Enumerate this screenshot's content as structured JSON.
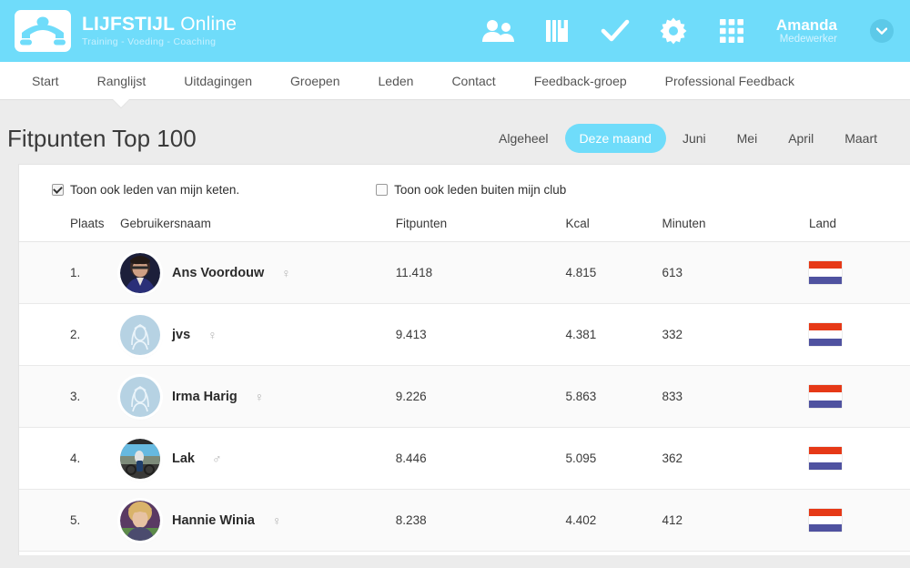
{
  "header": {
    "logo_icon": "pushup-silhouette-logo",
    "brand_title_bold": "LIJFSTIJL",
    "brand_title_thin": " Online",
    "brand_subtitle": "Training - Voeding - Coaching",
    "icons": [
      {
        "name": "people-icon",
        "glyph": "people"
      },
      {
        "name": "book-icon",
        "glyph": "book"
      },
      {
        "name": "check-icon",
        "glyph": "check"
      },
      {
        "name": "gear-icon",
        "glyph": "gear"
      },
      {
        "name": "grid-apps-icon",
        "glyph": "grid"
      }
    ],
    "user_name": "Amanda",
    "user_role": "Medewerker",
    "caret_icon": "chevron-down-icon",
    "background_color": "#6FDCFA"
  },
  "nav": {
    "items": [
      {
        "label": "Start",
        "active": false
      },
      {
        "label": "Ranglijst",
        "active": true
      },
      {
        "label": "Uitdagingen",
        "active": false
      },
      {
        "label": "Groepen",
        "active": false
      },
      {
        "label": "Leden",
        "active": false
      },
      {
        "label": "Contact",
        "active": false
      },
      {
        "label": "Feedback-groep",
        "active": false
      },
      {
        "label": "Professional Feedback",
        "active": false
      }
    ]
  },
  "page": {
    "title": "Fitpunten Top 100",
    "period_tabs": [
      {
        "label": "Algeheel",
        "active": false
      },
      {
        "label": "Deze maand",
        "active": true
      },
      {
        "label": "Juni",
        "active": false
      },
      {
        "label": "Mei",
        "active": false
      },
      {
        "label": "April",
        "active": false
      },
      {
        "label": "Maart",
        "active": false
      }
    ],
    "active_tab_color": "#6FDCFA"
  },
  "filters": [
    {
      "label": "Toon ook leden van mijn keten.",
      "checked": true
    },
    {
      "label": "Toon ook leden buiten mijn club",
      "checked": false
    }
  ],
  "table": {
    "columns": [
      "Plaats",
      "Gebruikersnaam",
      "Fitpunten",
      "Kcal",
      "Minuten",
      "Land"
    ],
    "rows": [
      {
        "plaats": "1.",
        "naam": "Ans Voordouw",
        "gender": "♀",
        "avatar_type": "photo-dark",
        "fitpunten": "11.418",
        "kcal": "4.815",
        "minuten": "613",
        "land": "nl-flag-icon"
      },
      {
        "plaats": "2.",
        "naam": "jvs",
        "gender": "♀",
        "avatar_type": "placeholder-female",
        "fitpunten": "9.413",
        "kcal": "4.381",
        "minuten": "332",
        "land": "nl-flag-icon"
      },
      {
        "plaats": "3.",
        "naam": "Irma Harig",
        "gender": "♀",
        "avatar_type": "placeholder-female",
        "fitpunten": "9.226",
        "kcal": "5.863",
        "minuten": "833",
        "land": "nl-flag-icon"
      },
      {
        "plaats": "4.",
        "naam": "Lak",
        "gender": "♂",
        "avatar_type": "photo-bike",
        "fitpunten": "8.446",
        "kcal": "5.095",
        "minuten": "362",
        "land": "nl-flag-icon"
      },
      {
        "plaats": "5.",
        "naam": "Hannie Winia",
        "gender": "♀",
        "avatar_type": "photo-blonde",
        "fitpunten": "8.238",
        "kcal": "4.402",
        "minuten": "412",
        "land": "nl-flag-icon"
      }
    ]
  }
}
